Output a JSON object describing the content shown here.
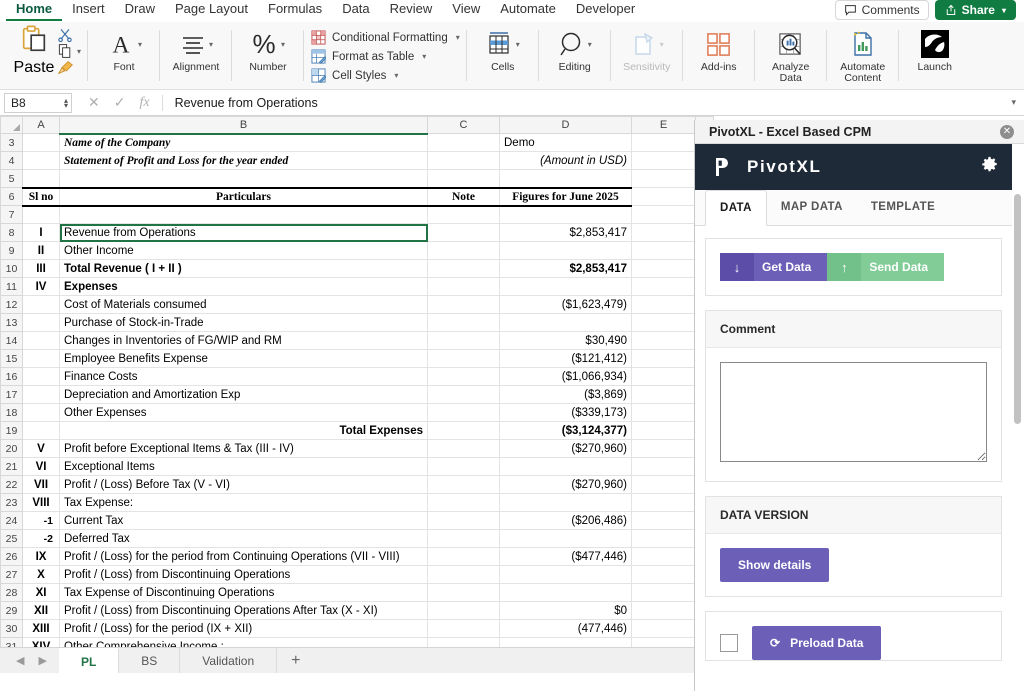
{
  "ribbon": {
    "tabs": [
      {
        "label": "Home",
        "active": true
      },
      {
        "label": "Insert",
        "active": false
      },
      {
        "label": "Draw",
        "active": false
      },
      {
        "label": "Page Layout",
        "active": false
      },
      {
        "label": "Formulas",
        "active": false
      },
      {
        "label": "Data",
        "active": false
      },
      {
        "label": "Review",
        "active": false
      },
      {
        "label": "View",
        "active": false
      },
      {
        "label": "Automate",
        "active": false
      },
      {
        "label": "Developer",
        "active": false
      }
    ],
    "comments_label": "Comments",
    "share_label": "Share",
    "groups": {
      "paste": "Paste",
      "font": "Font",
      "alignment": "Alignment",
      "number": "Number",
      "conditional_formatting": "Conditional Formatting",
      "format_as_table": "Format as Table",
      "cell_styles": "Cell Styles",
      "cells": "Cells",
      "editing": "Editing",
      "sensitivity": "Sensitivity",
      "addins": "Add-ins",
      "analyze_data": "Analyze Data",
      "automate_content": "Automate Content",
      "launch": "Launch"
    }
  },
  "formula_bar": {
    "name_box": "B8",
    "content": "Revenue from Operations"
  },
  "grid": {
    "columns": [
      "A",
      "B",
      "C",
      "D",
      "E"
    ],
    "selected_cell": "B8",
    "rows": [
      {
        "n": "3",
        "a": "",
        "b": "Name of the Company",
        "c": "",
        "d": "Demo",
        "style": "title",
        "d_align": "left"
      },
      {
        "n": "4",
        "a": "",
        "b": "Statement of Profit and Loss for the year ended",
        "c": "",
        "d": "(Amount in USD)",
        "style": "title",
        "d_align": "right"
      },
      {
        "n": "5",
        "a": "",
        "b": "",
        "c": "",
        "d": ""
      },
      {
        "n": "6",
        "a": "Sl no",
        "b": "Particulars",
        "c": "Note",
        "d": "Figures for June 2025",
        "style": "header"
      },
      {
        "n": "7",
        "a": "",
        "b": "",
        "c": "",
        "d": ""
      },
      {
        "n": "8",
        "a": "I",
        "b": "Revenue from Operations",
        "c": "",
        "d": "$2,853,417",
        "selected": true
      },
      {
        "n": "9",
        "a": "II",
        "b": "Other Income",
        "c": "",
        "d": ""
      },
      {
        "n": "10",
        "a": "III",
        "b": "Total Revenue ( I + II )",
        "c": "",
        "d": "$2,853,417",
        "style": "bold"
      },
      {
        "n": "11",
        "a": "IV",
        "b": "Expenses",
        "c": "",
        "d": "",
        "style": "bold"
      },
      {
        "n": "12",
        "a": "",
        "b": "Cost of Materials consumed",
        "c": "",
        "d": "($1,623,479)",
        "neg": true
      },
      {
        "n": "13",
        "a": "",
        "b": "Purchase of Stock-in-Trade",
        "c": "",
        "d": ""
      },
      {
        "n": "14",
        "a": "",
        "b": "Changes in Inventories of FG/WIP and RM",
        "c": "",
        "d": "$30,490"
      },
      {
        "n": "15",
        "a": "",
        "b": "Employee Benefits Expense",
        "c": "",
        "d": "($121,412)",
        "neg": true
      },
      {
        "n": "16",
        "a": "",
        "b": "Finance Costs",
        "c": "",
        "d": "($1,066,934)",
        "neg": true
      },
      {
        "n": "17",
        "a": "",
        "b": "Depreciation and Amortization Exp",
        "c": "",
        "d": "($3,869)",
        "neg": true
      },
      {
        "n": "18",
        "a": "",
        "b": "Other Expenses",
        "c": "",
        "d": "($339,173)",
        "neg": true
      },
      {
        "n": "19",
        "a": "",
        "b": "Total Expenses",
        "c": "",
        "d": "($3,124,377)",
        "neg": true,
        "style": "bold",
        "b_align": "right"
      },
      {
        "n": "20",
        "a": "V",
        "b": "Profit before Exceptional Items & Tax (III - IV)",
        "c": "",
        "d": "($270,960)",
        "neg": true
      },
      {
        "n": "21",
        "a": "VI",
        "b": "Exceptional Items",
        "c": "",
        "d": ""
      },
      {
        "n": "22",
        "a": "VII",
        "b": "Profit / (Loss) Before Tax (V - VI)",
        "c": "",
        "d": "($270,960)",
        "neg": true
      },
      {
        "n": "23",
        "a": "VIII",
        "b": "Tax Expense:",
        "c": "",
        "d": ""
      },
      {
        "n": "24",
        "a": "-1",
        "b": "Current Tax",
        "c": "",
        "d": "($206,486)",
        "neg": true,
        "indent": true
      },
      {
        "n": "25",
        "a": "-2",
        "b": "Deferred Tax",
        "c": "",
        "d": "",
        "indent": true
      },
      {
        "n": "26",
        "a": "IX",
        "b": "Profit / (Loss) for the period from Continuing Operations (VII - VIII)",
        "c": "",
        "d": "($477,446)",
        "neg": true
      },
      {
        "n": "27",
        "a": "X",
        "b": "Profit / (Loss) from Discontinuing Operations",
        "c": "",
        "d": ""
      },
      {
        "n": "28",
        "a": "XI",
        "b": "Tax Expense of Discontinuing Operations",
        "c": "",
        "d": ""
      },
      {
        "n": "29",
        "a": "XII",
        "b": "Profit / (Loss)  from Discontinuing Operations After Tax (X - XI)",
        "c": "",
        "d": "$0"
      },
      {
        "n": "30",
        "a": "XIII",
        "b": "Profit / (Loss) for the period (IX + XII)",
        "c": "",
        "d": "(477,446)"
      },
      {
        "n": "31",
        "a": "XIV",
        "b": "Other Comprehensive Income :",
        "c": "",
        "d": ""
      }
    ]
  },
  "sheet_tabs": {
    "items": [
      {
        "label": "PL",
        "active": true
      },
      {
        "label": "BS",
        "active": false
      },
      {
        "label": "Validation",
        "active": false
      }
    ],
    "add_label": "+"
  },
  "pane": {
    "title": "PivotXL - Excel Based CPM",
    "app_name": "PivotXL",
    "tabs": [
      {
        "label": "DATA",
        "active": true
      },
      {
        "label": "MAP DATA",
        "active": false
      },
      {
        "label": "TEMPLATE",
        "active": false
      }
    ],
    "get_data_label": "Get Data",
    "send_data_label": "Send Data",
    "comment_label": "Comment",
    "comment_value": "",
    "data_version_label": "DATA VERSION",
    "show_details_label": "Show details",
    "preload_label": "Preload Data"
  },
  "colors": {
    "excel_green": "#107c41",
    "pane_header": "#1e2a38",
    "purple": "#6c5fb8",
    "green_btn": "#82cc98",
    "negative_red": "#e03030"
  }
}
